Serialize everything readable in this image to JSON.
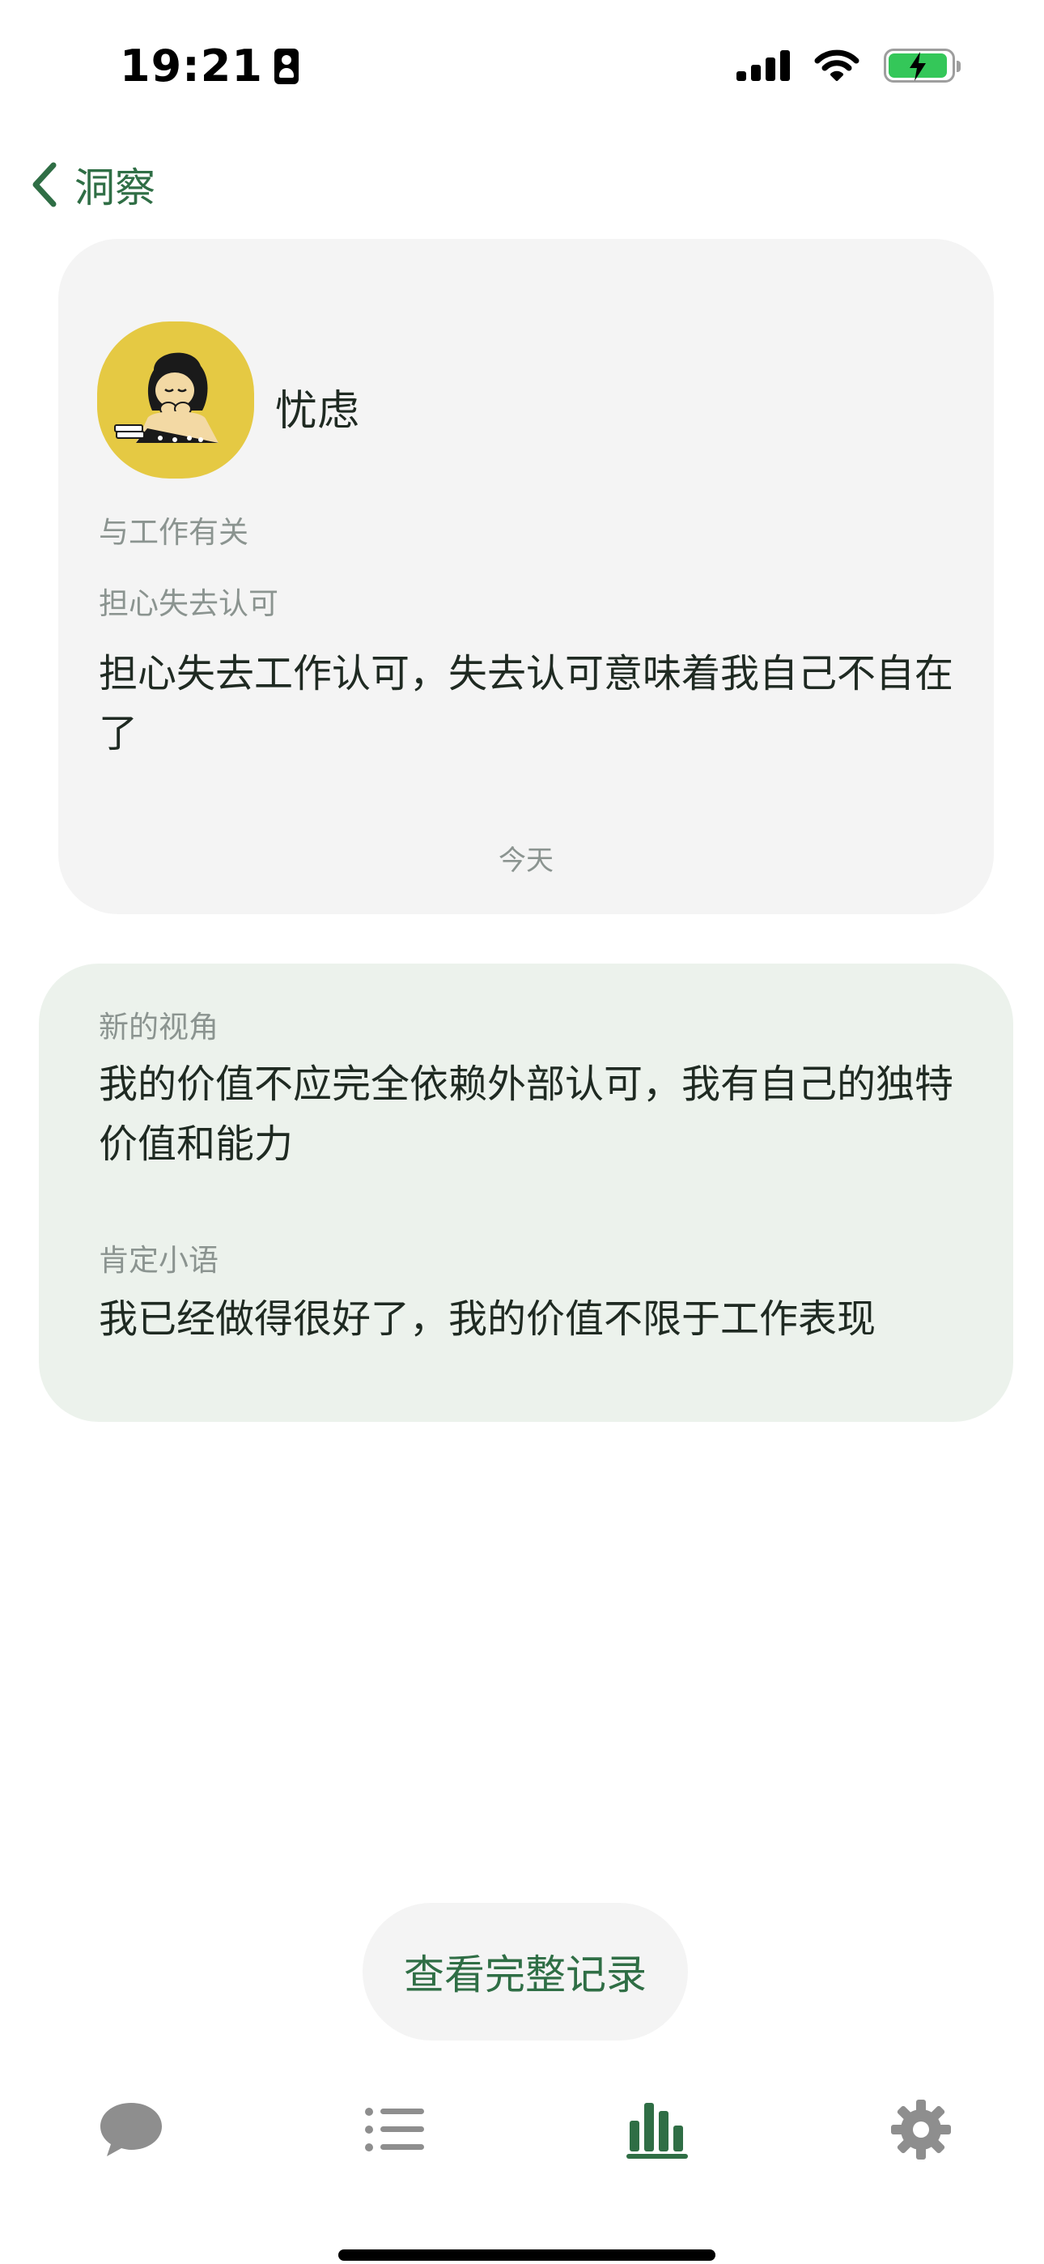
{
  "status_bar": {
    "time": "19:21",
    "battery_color": "#34c759"
  },
  "nav": {
    "back_label": "洞察",
    "back_icon": "chevron-left-icon",
    "accent_color": "#2f6e45"
  },
  "entry": {
    "emotion": "忧虑",
    "avatar_icon": "worried-girl-illustration",
    "category": "与工作有关",
    "subcategory": "担心失去认可",
    "text": "担心失去工作认可，失去认可意味着我自己不自在了",
    "date": "今天"
  },
  "insight": {
    "perspective_label": "新的视角",
    "perspective_text": "我的价值不应完全依赖外部认可，我有自己的独特价值和能力",
    "affirmation_label": "肯定小语",
    "affirmation_text": "我已经做得很好了，我的价值不限于工作表现"
  },
  "actions": {
    "view_record_label": "查看完整记录"
  },
  "tab_bar": {
    "items": [
      {
        "name": "chat",
        "icon": "chat-bubble-icon",
        "active": false
      },
      {
        "name": "list",
        "icon": "list-icon",
        "active": false
      },
      {
        "name": "insights",
        "icon": "bar-chart-icon",
        "active": true
      },
      {
        "name": "settings",
        "icon": "gear-icon",
        "active": false
      }
    ],
    "active_color": "#2f6e45",
    "inactive_color": "#8e8e8e"
  }
}
